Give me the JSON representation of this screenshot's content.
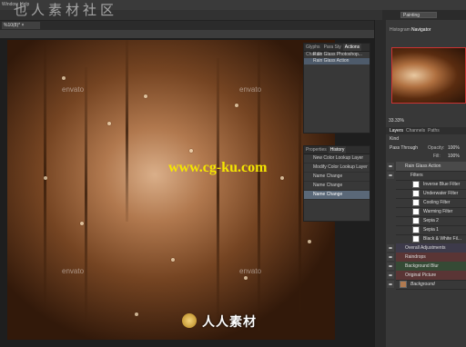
{
  "app": {
    "menu": [
      "Window",
      "Help"
    ],
    "workspace_label": "Painting",
    "document_tab": "%10(8)* ×"
  },
  "watermarks": {
    "top_text": "也人素材社区",
    "center_text": "www.cg-ku.com",
    "bottom_text": "人人素材",
    "envato": "envato"
  },
  "actions_panel": {
    "tabs": [
      "Glyphs",
      "Para Sty",
      "Actions",
      "Char St",
      "Para"
    ],
    "active_tab": "Actions",
    "rows": [
      "Rain Glass Photoshop...",
      "Rain Glass Action"
    ]
  },
  "history_panel": {
    "tabs": [
      "Properties",
      "History"
    ],
    "active_tab": "History",
    "rows": [
      "New Color Lookup Layer",
      "Modify Color Lookup Layer",
      "Name Change",
      "Name Change",
      "Name Change"
    ]
  },
  "right_panel": {
    "tabs": [
      "Histogram",
      "Navigator"
    ],
    "active_tab": "Navigator",
    "zoom": "33.33%"
  },
  "layers_panel": {
    "tabs": [
      "Layers",
      "Channels",
      "Paths"
    ],
    "blend_mode": "Pass Through",
    "opacity_label": "Opacity:",
    "opacity_value": "100%",
    "fill_label": "Fill:",
    "fill_value": "100%",
    "kind_label": "Kind",
    "rows": [
      "Rain Glass Action",
      "Filters",
      "Inverse Blue Filter",
      "Underwater Filter",
      "Cooling Filter",
      "Warming Filter",
      "Sepia 2",
      "Sepia 1",
      "Black & White Fil...",
      "Overall Adjustments",
      "Raindrops",
      "Background Blur",
      "Original Picture",
      "Background"
    ]
  }
}
